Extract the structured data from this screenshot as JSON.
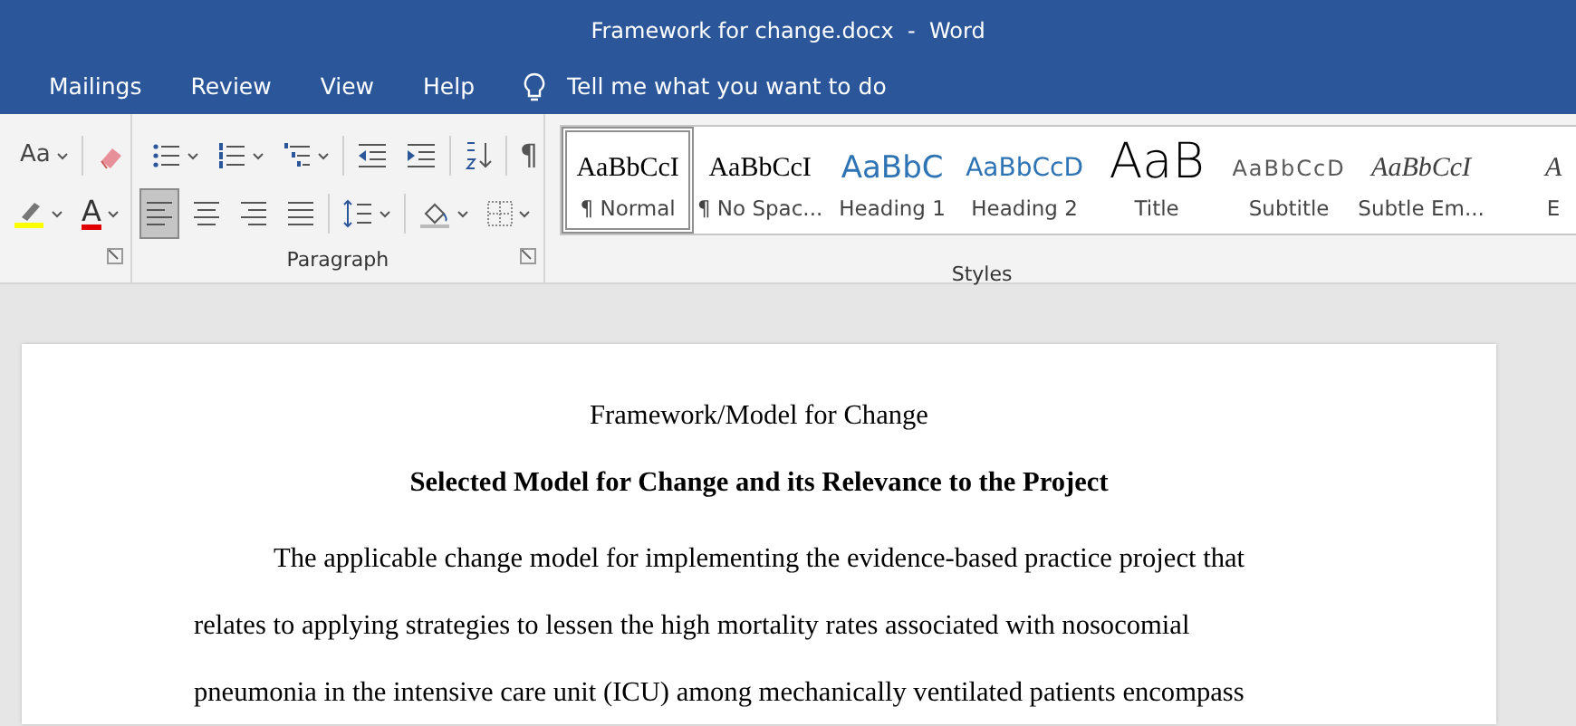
{
  "window": {
    "title": "Framework for change.docx  -  Word"
  },
  "tabs": [
    {
      "label": "Mailings",
      "selected": false
    },
    {
      "label": "Review",
      "selected": false
    },
    {
      "label": "View",
      "selected": false
    },
    {
      "label": "Help",
      "selected": false
    }
  ],
  "tell_me": {
    "placeholder": "Tell me what you want to do"
  },
  "font_group": {
    "change_case": "Aa",
    "font_color_glyph": "A"
  },
  "paragraph_group": {
    "label": "Paragraph",
    "show_marks": "¶",
    "alignment": [
      {
        "kind": "left",
        "selected": true
      },
      {
        "kind": "center",
        "selected": false
      },
      {
        "kind": "right",
        "selected": false
      },
      {
        "kind": "justify",
        "selected": false
      }
    ]
  },
  "styles_group": {
    "label": "Styles",
    "items": [
      {
        "preview": "AaBbCcI",
        "label": "¶ Normal",
        "kind": "serif",
        "selected": true
      },
      {
        "preview": "AaBbCcI",
        "label": "¶ No Spac...",
        "kind": "serif",
        "selected": false
      },
      {
        "preview": "AaBbC",
        "label": "Heading 1",
        "kind": "heading1",
        "selected": false
      },
      {
        "preview": "AaBbCcD",
        "label": "Heading 2",
        "kind": "heading2",
        "selected": false
      },
      {
        "preview": "AaB",
        "label": "Title",
        "kind": "title",
        "selected": false
      },
      {
        "preview": "AaBbCcD",
        "label": "Subtitle",
        "kind": "subtitle",
        "selected": false
      },
      {
        "preview": "AaBbCcI",
        "label": "Subtle Em...",
        "kind": "italic",
        "selected": false
      },
      {
        "preview": "A",
        "label": "E",
        "kind": "italic",
        "selected": false
      }
    ]
  },
  "document": {
    "heading": "Framework/Model for Change",
    "subheading": "Selected Model for Change and its Relevance to the Project",
    "paragraph": "The applicable change model for implementing the evidence-based practice project that relates to applying strategies to lessen the high mortality rates associated with nosocomial pneumonia in the intensive care unit (ICU) among mechanically ventilated patients encompass"
  }
}
